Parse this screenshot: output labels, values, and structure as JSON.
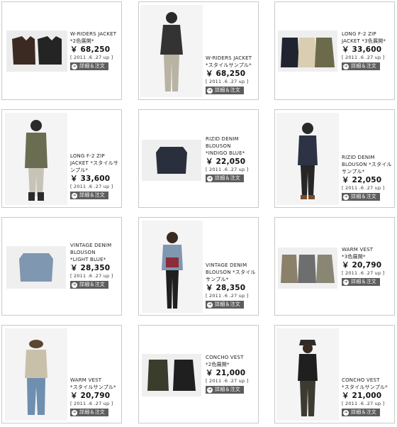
{
  "button_label": "詳細＆注文",
  "arrow_glyph": "➔",
  "products": [
    {
      "name": "W-RIDERS JACKET",
      "variant": "*2色展開*",
      "price": "￥ 68,250",
      "date": "[ 2011 .6 .27 up ]",
      "thumb": "two-leather-jackets"
    },
    {
      "name": "W-RIDERS JACKET",
      "variant": "*スタイルサンプル*",
      "price": "￥ 68,250",
      "date": "[ 2011 .6 .27 up ]",
      "thumb": "model-dark-jacket"
    },
    {
      "name": "LONG F-2 ZIP",
      "variant": "JACKET *3色展開*",
      "price": "￥ 33,600",
      "date": "[ 2011 .6 .27 up ]",
      "thumb": "three-zip-jackets"
    },
    {
      "name": "LONG F-2 ZIP",
      "variant": "JACKET *スタイルサンプル*",
      "price": "￥ 33,600",
      "date": "[ 2011 .6 .27 up ]",
      "thumb": "model-olive-jacket"
    },
    {
      "name": "RIZID DENIM BLOUSON",
      "variant": "*INDIGO BLUE*",
      "price": "￥ 22,050",
      "date": "[ 2011 .6 .27 up ]",
      "thumb": "indigo-denim-jacket"
    },
    {
      "name": "RIZID DENIM",
      "variant": "BLOUSON *スタイルサンプル*",
      "price": "￥ 22,050",
      "date": "[ 2011 .6 .27 up ]",
      "thumb": "model-indigo-denim"
    },
    {
      "name": "VINTAGE DENIM BLOUSON",
      "variant": "*LIGHT BLUE*",
      "price": "￥ 28,350",
      "date": "[ 2011 .6 .27 up ]",
      "thumb": "light-denim-jacket"
    },
    {
      "name": "VINTAGE DENIM",
      "variant": "BLOUSON *スタイルサンプル*",
      "price": "￥ 28,350",
      "date": "[ 2011 .6 .27 up ]",
      "thumb": "model-light-denim"
    },
    {
      "name": "WARM VEST",
      "variant": "*3色展開*",
      "price": "￥ 20,790",
      "date": "[ 2011 .6 .27 up ]",
      "thumb": "three-vests"
    },
    {
      "name": "WARM VEST",
      "variant": "*スタイルサンプル*",
      "price": "￥ 20,790",
      "date": "[ 2011 .6 .27 up ]",
      "thumb": "model-warm-vest"
    },
    {
      "name": "CONCHO VEST",
      "variant": "*2色展開*",
      "price": "￥ 21,000",
      "date": "[ 2011 .6 .27 up ]",
      "thumb": "two-concho-vests"
    },
    {
      "name": "CONCHO VEST",
      "variant": "*スタイルサンプル*",
      "price": "￥ 21,000",
      "date": "[ 2011 .6 .27 up ]",
      "thumb": "model-concho-vest"
    }
  ]
}
